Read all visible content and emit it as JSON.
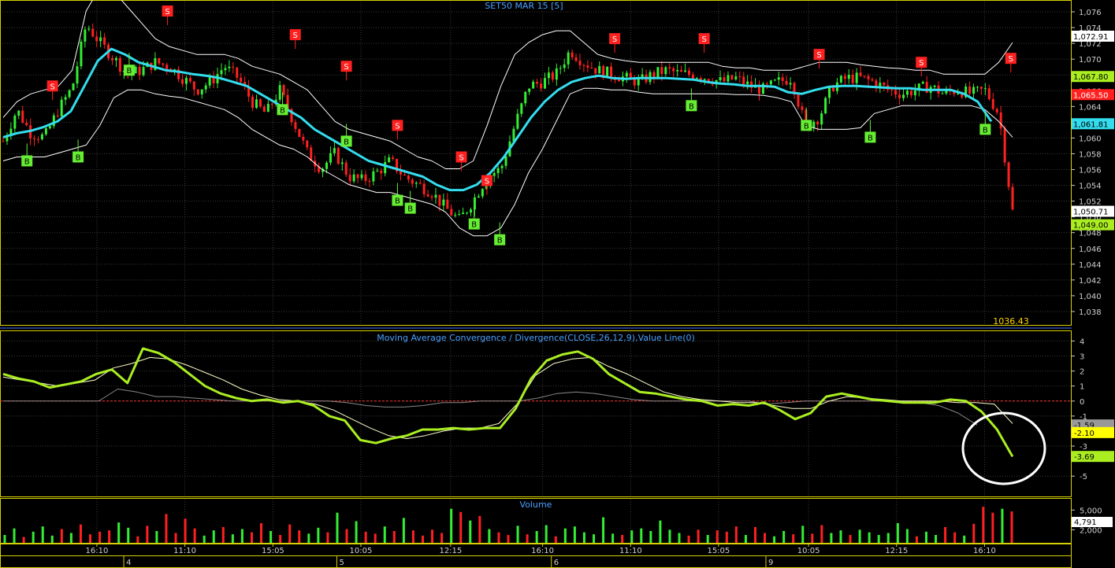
{
  "colors": {
    "background": "#000000",
    "grid": "#3a3a3a",
    "frame": "#d8d000",
    "separator": "#4a6cff",
    "title": "#4aa0ff",
    "axis_text": "#cfcfcf",
    "up": "#33ee33",
    "down": "#ff2020",
    "ma": "#33ddee",
    "bands": "#ffffff",
    "macd": "#aaee22",
    "signal": "#ffffcc",
    "histogram": "#888888",
    "zero_line": "#ff3030",
    "circle": "#ffffff",
    "buy_marker": "#66ee33",
    "sell_marker": "#ff2020"
  },
  "chart_data": [
    {
      "type": "line",
      "title": "SET50 MAR 15  [5]",
      "ylim": [
        1036.4,
        1077.3
      ],
      "y_ticks": [
        "1,076",
        "1,074",
        "1,072",
        "1,070",
        "1,068",
        "1,066",
        "1,064",
        "1,062",
        "1,060",
        "1,058",
        "1,056",
        "1,054",
        "1,052",
        "1,050",
        "1,048",
        "1,046",
        "1,044",
        "1,042",
        "1,040",
        "1,038"
      ],
      "grid": true,
      "bottom_value": "1036.43",
      "series": [
        {
          "role": "close",
          "values": [
            1059.6,
            1063.6,
            1060.6,
            1060.1,
            1063.6,
            1066.4,
            1074.4,
            1072.1,
            1070.1,
            1068.1,
            1068.6,
            1069.6,
            1069.1,
            1067.6,
            1066.1,
            1067.1,
            1069.1,
            1067.6,
            1064.6,
            1063.1,
            1066.1,
            1062.1,
            1058.1,
            1056.1,
            1058.1,
            1055.1,
            1054.6,
            1055.6,
            1057.1,
            1055.1,
            1054.1,
            1053.1,
            1051.1,
            1049.6,
            1052.1,
            1055.1,
            1056.1,
            1061.6,
            1066.6,
            1067.1,
            1068.1,
            1071.1,
            1069.6,
            1068.6,
            1068.1,
            1067.6,
            1067.1,
            1068.1,
            1068.6,
            1068.1,
            1068.1,
            1067.6,
            1067.1,
            1067.6,
            1066.6,
            1066.1,
            1067.1,
            1067.6,
            1061.6,
            1062.6,
            1066.6,
            1067.6,
            1067.6,
            1067.1,
            1066.1,
            1065.6,
            1066.1,
            1066.6,
            1065.6,
            1066.1,
            1065.6,
            1066.1,
            1063.1,
            1050.7
          ]
        },
        {
          "role": "moving_average",
          "values": [
            1060.1,
            1060.6,
            1060.9,
            1061.4,
            1062.1,
            1063.4,
            1066.6,
            1069.8,
            1071.3,
            1070.6,
            1069.6,
            1069.1,
            1068.6,
            1068.4,
            1068.1,
            1067.9,
            1067.6,
            1067.1,
            1066.6,
            1065.6,
            1064.6,
            1063.6,
            1062.6,
            1061.1,
            1060.1,
            1059.1,
            1058.1,
            1057.1,
            1056.6,
            1056.1,
            1055.6,
            1055.1,
            1054.1,
            1053.4,
            1053.4,
            1054.1,
            1055.6,
            1057.6,
            1060.1,
            1062.6,
            1064.6,
            1066.1,
            1067.1,
            1067.6,
            1067.9,
            1067.6,
            1067.5,
            1067.6,
            1067.6,
            1067.6,
            1067.5,
            1067.4,
            1067.1,
            1066.9,
            1066.8,
            1066.6,
            1066.6,
            1066.5,
            1065.8,
            1065.6,
            1066.1,
            1066.5,
            1066.6,
            1066.6,
            1066.5,
            1066.4,
            1066.3,
            1066.3,
            1066.1,
            1066.1,
            1066.1,
            1065.6,
            1064.6,
            1062.1
          ]
        },
        {
          "role": "upper_band",
          "values": [
            1062.6,
            1064.6,
            1065.6,
            1066.1,
            1066.6,
            1068.6,
            1076.1,
            1079.1,
            1078.6,
            1076.6,
            1074.6,
            1072.6,
            1071.6,
            1071.1,
            1070.6,
            1070.6,
            1070.6,
            1070.1,
            1069.1,
            1068.6,
            1068.1,
            1067.1,
            1066.1,
            1064.1,
            1062.1,
            1061.1,
            1060.6,
            1060.1,
            1059.6,
            1058.6,
            1057.6,
            1057.1,
            1056.1,
            1056.1,
            1057.1,
            1061.6,
            1066.6,
            1070.6,
            1072.1,
            1073.1,
            1073.6,
            1073.6,
            1072.1,
            1070.6,
            1070.1,
            1069.8,
            1069.6,
            1069.6,
            1069.6,
            1069.6,
            1069.6,
            1069.6,
            1069.1,
            1068.9,
            1068.9,
            1068.6,
            1068.6,
            1068.6,
            1069.1,
            1069.6,
            1069.6,
            1069.6,
            1069.3,
            1069.1,
            1068.9,
            1068.8,
            1068.6,
            1068.6,
            1068.1,
            1068.1,
            1068.1,
            1068.1,
            1069.6,
            1072.1
          ]
        },
        {
          "role": "lower_band",
          "values": [
            1057.1,
            1057.6,
            1057.6,
            1057.6,
            1058.1,
            1058.6,
            1059.1,
            1061.6,
            1065.1,
            1066.1,
            1066.1,
            1065.6,
            1065.3,
            1065.1,
            1064.6,
            1064.1,
            1063.6,
            1062.6,
            1061.1,
            1060.1,
            1059.1,
            1058.6,
            1057.6,
            1056.1,
            1055.1,
            1054.1,
            1053.6,
            1053.1,
            1053.1,
            1052.6,
            1052.1,
            1051.6,
            1050.6,
            1048.6,
            1047.6,
            1047.6,
            1048.6,
            1051.6,
            1055.6,
            1058.6,
            1062.1,
            1065.6,
            1066.3,
            1066.3,
            1066.1,
            1066.1,
            1065.8,
            1065.6,
            1065.6,
            1065.6,
            1065.6,
            1065.6,
            1065.6,
            1065.5,
            1065.5,
            1065.4,
            1065.1,
            1064.6,
            1061.6,
            1061.1,
            1061.1,
            1061.1,
            1061.3,
            1063.1,
            1063.6,
            1064.1,
            1064.1,
            1064.1,
            1064.1,
            1064.1,
            1064.1,
            1063.6,
            1062.1,
            1060.1
          ]
        }
      ],
      "signals": [
        {
          "label": "B",
          "i": 1,
          "v": 1057.1
        },
        {
          "label": "B",
          "i": 5,
          "v": 1057.6
        },
        {
          "label": "S",
          "i": 3,
          "v": 1066.6
        },
        {
          "label": "B",
          "i": 9,
          "v": 1068.6
        },
        {
          "label": "S",
          "i": 12,
          "v": 1076.1
        },
        {
          "label": "S",
          "i": 22,
          "v": 1073.1
        },
        {
          "label": "B",
          "i": 21,
          "v": 1063.6
        },
        {
          "label": "S",
          "i": 26,
          "v": 1069.1
        },
        {
          "label": "B",
          "i": 26,
          "v": 1059.6
        },
        {
          "label": "S",
          "i": 30,
          "v": 1061.6
        },
        {
          "label": "B",
          "i": 30,
          "v": 1052.1
        },
        {
          "label": "B",
          "i": 31,
          "v": 1051.1
        },
        {
          "label": "S",
          "i": 35,
          "v": 1057.6
        },
        {
          "label": "S",
          "i": 37,
          "v": 1054.6
        },
        {
          "label": "B",
          "i": 36,
          "v": 1049.1
        },
        {
          "label": "B",
          "i": 38,
          "v": 1047.1
        },
        {
          "label": "S",
          "i": 47,
          "v": 1072.6
        },
        {
          "label": "S",
          "i": 54,
          "v": 1072.6
        },
        {
          "label": "B",
          "i": 53,
          "v": 1064.1
        },
        {
          "label": "S",
          "i": 63,
          "v": 1070.6
        },
        {
          "label": "B",
          "i": 62,
          "v": 1061.6
        },
        {
          "label": "B",
          "i": 67,
          "v": 1060.1
        },
        {
          "label": "S",
          "i": 71,
          "v": 1069.6
        },
        {
          "label": "S",
          "i": 78,
          "v": 1070.1
        },
        {
          "label": "B",
          "i": 76,
          "v": 1061.1
        }
      ],
      "price_tags": [
        {
          "text": "1,072.91",
          "value": 1072.91,
          "bg": "#ffffff",
          "fg": "#000000"
        },
        {
          "text": "1,067.80",
          "value": 1067.8,
          "bg": "#aaee22",
          "fg": "#000000"
        },
        {
          "text": "1,065.50",
          "value": 1065.5,
          "bg": "#ff2020",
          "fg": "#ffffff"
        },
        {
          "text": "1,061.81",
          "value": 1061.81,
          "bg": "#33ddee",
          "fg": "#000000"
        },
        {
          "text": "1,050.71",
          "value": 1050.71,
          "bg": "#ffffff",
          "fg": "#000000"
        },
        {
          "text": "1,049.00",
          "value": 1049.0,
          "bg": "#aaee22",
          "fg": "#000000"
        }
      ]
    },
    {
      "type": "line",
      "title": "Moving Average Convergence / Divergence(CLOSE,26,12,9),Value Line(0)",
      "ylim": [
        -6.3,
        4.6
      ],
      "y_ticks": [
        "4",
        "3",
        "2",
        "1",
        "0",
        "-1",
        "-3",
        "-5"
      ],
      "series": [
        {
          "role": "macd",
          "values": [
            1.8,
            1.5,
            1.3,
            0.9,
            1.1,
            1.3,
            1.8,
            2.1,
            1.2,
            3.5,
            3.2,
            2.6,
            1.8,
            1.0,
            0.5,
            0.2,
            0.0,
            0.1,
            -0.1,
            0.0,
            -0.3,
            -1.0,
            -1.3,
            -2.6,
            -2.8,
            -2.5,
            -2.3,
            -1.9,
            -1.9,
            -1.8,
            -1.9,
            -1.8,
            -1.8,
            -0.5,
            1.5,
            2.7,
            3.1,
            3.3,
            2.8,
            1.8,
            1.2,
            0.6,
            0.5,
            0.3,
            0.1,
            0.0,
            -0.3,
            -0.2,
            -0.3,
            -0.1,
            -0.6,
            -1.2,
            -0.8,
            0.3,
            0.5,
            0.3,
            0.1,
            0.0,
            -0.1,
            -0.1,
            -0.1,
            0.1,
            0.0,
            -0.7,
            -1.9,
            -3.7
          ]
        },
        {
          "role": "signal",
          "values": [
            1.6,
            1.4,
            1.2,
            1.0,
            1.2,
            1.4,
            2.2,
            2.5,
            2.9,
            2.8,
            2.4,
            1.9,
            1.4,
            0.8,
            0.4,
            0.1,
            0.0,
            -0.2,
            -0.6,
            -1.2,
            -1.8,
            -2.3,
            -2.5,
            -2.3,
            -2.0,
            -1.8,
            -1.8,
            -1.5,
            -0.2,
            1.7,
            2.5,
            2.8,
            2.9,
            2.3,
            1.8,
            1.2,
            0.6,
            0.3,
            0.1,
            0.0,
            -0.1,
            -0.1,
            -0.3,
            -0.5,
            -0.5,
            0.0,
            0.3,
            0.2,
            0.1,
            0.0,
            0.0,
            0.0,
            -0.1,
            -0.1,
            -0.2,
            -1.5
          ]
        },
        {
          "role": "histogram",
          "values": [
            0.0,
            0.0,
            0.0,
            0.0,
            0.0,
            0.0,
            0.8,
            0.6,
            0.3,
            0.3,
            0.2,
            0.1,
            0.0,
            0.0,
            0.0,
            0.0,
            0.0,
            0.0,
            -0.1,
            -0.3,
            -0.4,
            -0.4,
            -0.3,
            -0.1,
            -0.1,
            0.0,
            0.0,
            0.0,
            0.2,
            0.5,
            0.6,
            0.5,
            0.3,
            0.1,
            0.0,
            0.0,
            0.0,
            0.0,
            0.0,
            0.0,
            -0.2,
            -0.1,
            0.0,
            0.0,
            0.0,
            0.0,
            0.0,
            0.0,
            -0.1,
            -0.3,
            -0.8,
            -1.6
          ]
        }
      ],
      "zero_line": 0,
      "value_tags": [
        {
          "text": "-1.59",
          "value": -1.59,
          "bg": "#999999",
          "fg": "#000000"
        },
        {
          "text": "-2.10",
          "value": -2.1,
          "bg": "#ffff00",
          "fg": "#000000"
        },
        {
          "text": "-3.69",
          "value": -3.69,
          "bg": "#aaee22",
          "fg": "#000000"
        }
      ]
    },
    {
      "type": "bar",
      "title": "Volume",
      "ylim": [
        0,
        6600
      ],
      "y_ticks": [
        "5,000",
        "2,000"
      ],
      "values": [
        1200,
        2200,
        900,
        1700,
        2500,
        1100,
        2100,
        1500,
        2800,
        1300,
        1700,
        1900,
        3100,
        2300,
        1000,
        2600,
        1800,
        4400,
        1500,
        3700,
        2200,
        1100,
        1900,
        2400,
        1300,
        2100,
        1600,
        3000,
        1800,
        1200,
        2800,
        1900,
        1400,
        2300,
        1600,
        4600,
        2100,
        3300,
        1700,
        1400,
        2500,
        1800,
        3800,
        1900,
        1100,
        2000,
        1500,
        5200,
        4700,
        3400,
        4100,
        2100,
        1600,
        1200,
        2600,
        1300,
        1800,
        2700,
        1000,
        2200,
        2500,
        1600,
        1300,
        3900,
        1400,
        1200,
        1900,
        2200,
        1800,
        3400,
        2000,
        1500,
        1100,
        2000,
        1200,
        1900,
        1700,
        2500,
        1200,
        2400,
        1500,
        1000,
        1800,
        1300,
        2600,
        1400,
        2700,
        1500,
        1900,
        1200,
        2000,
        1600,
        1200,
        1500,
        3000,
        2100,
        1000,
        1700,
        1200,
        2400,
        1600,
        1100,
        2900,
        5500,
        4600,
        5200,
        4791
      ],
      "value_tag": {
        "text": "4,791",
        "value": 4791
      }
    }
  ],
  "x_axis": {
    "time_labels": [
      {
        "text": "16:10",
        "frac": 0.0904
      },
      {
        "text": "11:10",
        "frac": 0.1725
      },
      {
        "text": "15:05",
        "frac": 0.2547
      },
      {
        "text": "10:05",
        "frac": 0.3367
      },
      {
        "text": "12:15",
        "frac": 0.4205
      },
      {
        "text": "16:10",
        "frac": 0.5063
      },
      {
        "text": "11:10",
        "frac": 0.5885
      },
      {
        "text": "15:05",
        "frac": 0.6705
      },
      {
        "text": "10:05",
        "frac": 0.7545
      },
      {
        "text": "12:15",
        "frac": 0.8366
      },
      {
        "text": "16:10",
        "frac": 0.9187
      }
    ],
    "day_labels": [
      {
        "text": "4",
        "frac": 0.1155
      },
      {
        "text": "5",
        "frac": 0.3143
      },
      {
        "text": "6",
        "frac": 0.5145
      },
      {
        "text": "9",
        "frac": 0.7147
      }
    ]
  }
}
